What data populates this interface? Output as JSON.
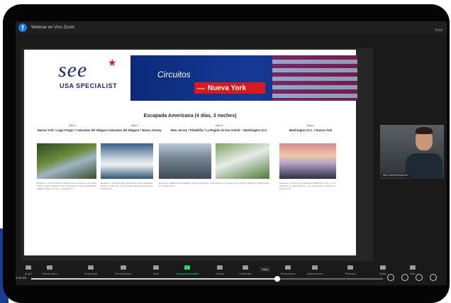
{
  "window": {
    "title": "Webinar en Vivo Zoom"
  },
  "top_right": {
    "text": "Vista"
  },
  "slide": {
    "logo": {
      "main": "see",
      "sub": "USA SPECIALIST"
    },
    "banner": {
      "circuitos": "Circuitos",
      "desde": "desde",
      "destino": "Nueva York"
    },
    "heading": "Escapada Americana (4 días, 3 noches)",
    "days": [
      {
        "day": "Día 1",
        "title": "Nueva York / Lago Finger / Cataratas del Niágara"
      },
      {
        "day": "Día 2",
        "title": "Cataratas del Niágara / Nueva Jersey"
      },
      {
        "day": "Día 3",
        "title": "New Jersey / Filadelfia / La Región de los Amish – Washington D.C."
      },
      {
        "day": "Día 4",
        "title": "Washington D.C. / Nueva York"
      }
    ],
    "paragraphs": [
      "Desayuno. Por la mañana salida hacia la región de los Lagos Finger. Visita a Watkins Glen. Continuación a las Cataratas del Niágara. Paseo en barco. Alojamiento.",
      "Desayuno. Visita del lado canadiense de las Cataratas. Regreso a EE. UU. y continuación hacia Nueva Jersey. Alojamiento.",
      "Desayuno. Salida hacia Filadelfia, visita de la ciudad. Continuación a la región de los Amish y después a Washington D.C. Alojamiento.",
      "Desayuno. Visita de la ciudad de Washington D.C. con el Capitolio, la Casa Blanca y los monumentos. Regreso a Nueva York."
    ]
  },
  "video": {
    "name": "SEE USA SPECIALIST"
  },
  "toolbar": {
    "items": [
      {
        "label": "Audio",
        "color": "#9c9c9c"
      },
      {
        "label": "Iniciar video",
        "color": "#9c9c9c"
      },
      {
        "label": "Seguridad",
        "color": "#9c9c9c"
      },
      {
        "label": "Participantes",
        "color": "#9c9c9c"
      },
      {
        "label": "Chat",
        "color": "#9c9c9c"
      },
      {
        "label": "Compartir pantalla",
        "color": "#23d96b"
      },
      {
        "label": "Grabar",
        "color": "#9c9c9c"
      },
      {
        "label": "Subtítulos",
        "color": "#9c9c9c"
      },
      {
        "label": "Reacciones",
        "color": "#9c9c9c"
      },
      {
        "label": "Aplicaciones",
        "color": "#9c9c9c"
      },
      {
        "label": "Pizarras",
        "color": "#9c9c9c"
      },
      {
        "label": "Notas",
        "color": "#9c9c9c"
      },
      {
        "label": "Más",
        "color": "#9c9c9c"
      }
    ],
    "vista": "Vista"
  },
  "progress": {
    "time": "1:14:34",
    "fraction": 0.7
  }
}
